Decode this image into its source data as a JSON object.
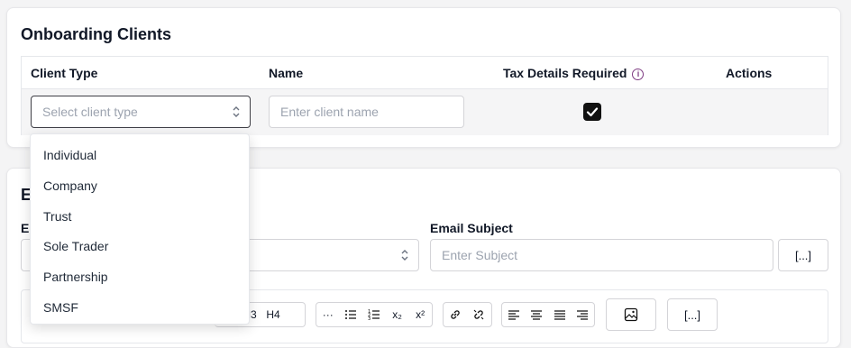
{
  "onboarding": {
    "title": "Onboarding Clients",
    "columns": {
      "client_type": "Client Type",
      "name": "Name",
      "tax_details": "Tax Details Required",
      "actions": "Actions"
    },
    "row": {
      "client_type_placeholder": "Select client type",
      "name_placeholder": "Enter client name",
      "tax_details_checked": true
    },
    "client_type_options": [
      "Individual",
      "Company",
      "Trust",
      "Sole Trader",
      "Partnership",
      "SMSF"
    ]
  },
  "email": {
    "title_partial": "E",
    "template_label_partial": "E",
    "subject_label": "Email Subject",
    "subject_placeholder": "Enter Subject",
    "placeholder_button": "[...]",
    "toolbar": {
      "h3": "H3",
      "h4": "H4",
      "more": "···",
      "subscript": "x₂",
      "superscript": "x²",
      "insert_placeholder": "[...]"
    }
  },
  "colors": {
    "accent": "#7e3c82",
    "checkbox": "#111111",
    "border": "#d4d4d8"
  }
}
